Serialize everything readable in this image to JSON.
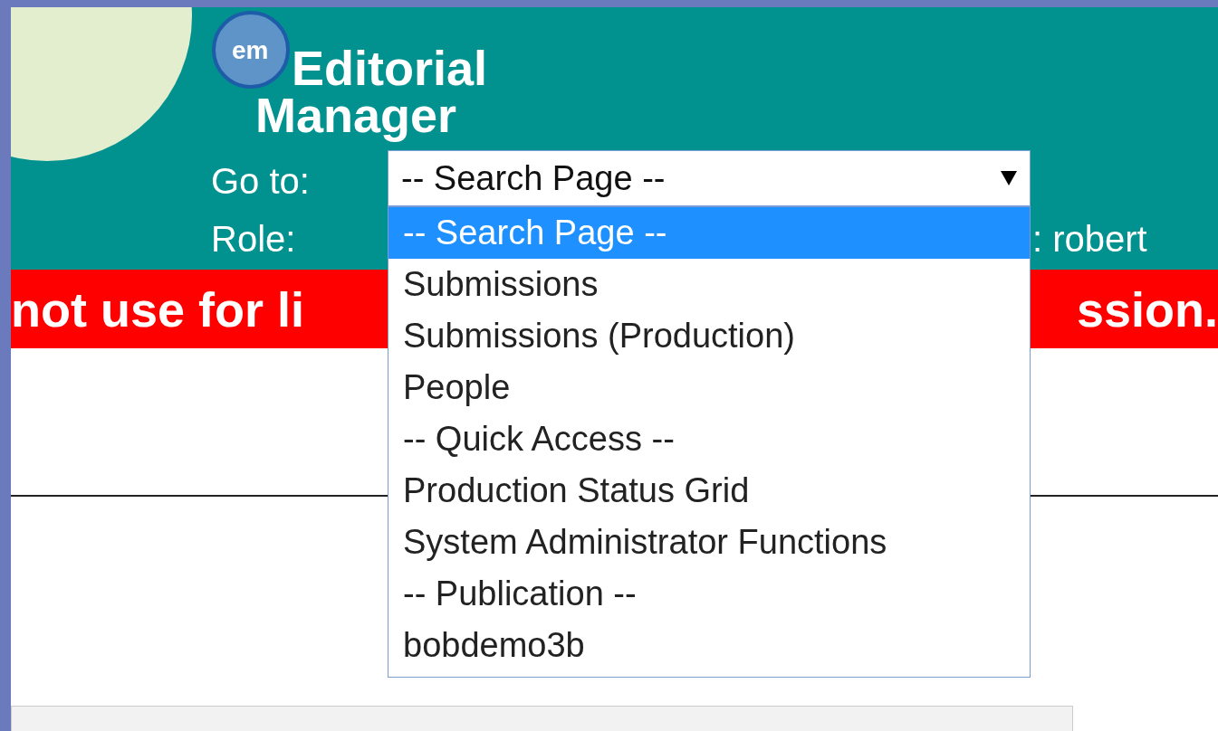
{
  "logo": {
    "badge": "em",
    "line_1": "Editorial",
    "line_2": "Manager"
  },
  "goto": {
    "label": "Go to:",
    "value": "-- Search Page --",
    "expanded": true,
    "options": [
      {
        "label": "-- Search Page --",
        "selected": true
      },
      {
        "label": "Submissions",
        "selected": false
      },
      {
        "label": "Submissions (Production)",
        "selected": false
      },
      {
        "label": "People",
        "selected": false
      },
      {
        "label": "-- Quick Access --",
        "selected": false
      },
      {
        "label": "Production Status Grid",
        "selected": false
      },
      {
        "label": "System Administrator Functions",
        "selected": false
      },
      {
        "label": "-- Publication --",
        "selected": false
      },
      {
        "label": "bobdemo3b",
        "selected": false
      }
    ]
  },
  "role": {
    "label": "Role:",
    "user_fragment": ": robert"
  },
  "banner": {
    "left_fragment": "not use for li",
    "right_fragment": "ssion."
  }
}
